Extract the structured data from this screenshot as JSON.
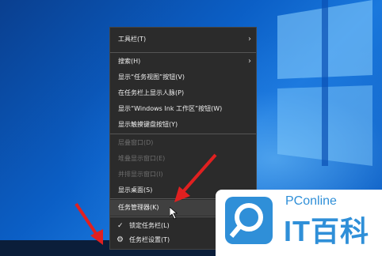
{
  "menu": {
    "items": [
      {
        "label": "工具栏(T)",
        "submenu": true
      },
      {
        "label": "搜索(H)",
        "submenu": true
      },
      {
        "label": "显示“任务视图”按钮(V)"
      },
      {
        "label": "在任务栏上显示人脉(P)"
      },
      {
        "label": "显示“Windows Ink 工作区”按钮(W)"
      },
      {
        "label": "显示触摸键盘按钮(Y)"
      },
      {
        "label": "层叠窗口(D)",
        "disabled": true
      },
      {
        "label": "堆叠显示窗口(E)",
        "disabled": true
      },
      {
        "label": "并排显示窗口(I)",
        "disabled": true
      },
      {
        "label": "显示桌面(S)"
      },
      {
        "label": "任务管理器(K)",
        "highlight": true
      },
      {
        "label": "锁定任务栏(L)",
        "checked": true
      },
      {
        "label": "任务栏设置(T)",
        "icon": "gear-icon"
      }
    ]
  },
  "watermark": {
    "brand_top": "PConline",
    "brand_main": "IT百科"
  },
  "colors": {
    "menu_bg": "#2b2b2b",
    "accent": "#2f8fd8",
    "arrow": "#e02020"
  }
}
